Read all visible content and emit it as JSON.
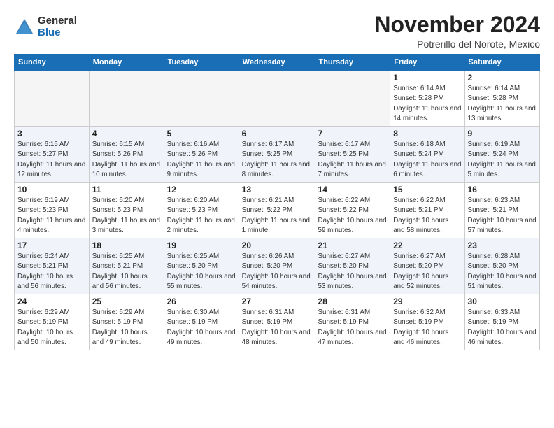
{
  "logo": {
    "general": "General",
    "blue": "Blue"
  },
  "title": "November 2024",
  "subtitle": "Potrerillo del Norote, Mexico",
  "weekdays": [
    "Sunday",
    "Monday",
    "Tuesday",
    "Wednesday",
    "Thursday",
    "Friday",
    "Saturday"
  ],
  "weeks": [
    [
      {
        "day": "",
        "info": ""
      },
      {
        "day": "",
        "info": ""
      },
      {
        "day": "",
        "info": ""
      },
      {
        "day": "",
        "info": ""
      },
      {
        "day": "",
        "info": ""
      },
      {
        "day": "1",
        "info": "Sunrise: 6:14 AM\nSunset: 5:28 PM\nDaylight: 11 hours and 14 minutes."
      },
      {
        "day": "2",
        "info": "Sunrise: 6:14 AM\nSunset: 5:28 PM\nDaylight: 11 hours and 13 minutes."
      }
    ],
    [
      {
        "day": "3",
        "info": "Sunrise: 6:15 AM\nSunset: 5:27 PM\nDaylight: 11 hours and 12 minutes."
      },
      {
        "day": "4",
        "info": "Sunrise: 6:15 AM\nSunset: 5:26 PM\nDaylight: 11 hours and 10 minutes."
      },
      {
        "day": "5",
        "info": "Sunrise: 6:16 AM\nSunset: 5:26 PM\nDaylight: 11 hours and 9 minutes."
      },
      {
        "day": "6",
        "info": "Sunrise: 6:17 AM\nSunset: 5:25 PM\nDaylight: 11 hours and 8 minutes."
      },
      {
        "day": "7",
        "info": "Sunrise: 6:17 AM\nSunset: 5:25 PM\nDaylight: 11 hours and 7 minutes."
      },
      {
        "day": "8",
        "info": "Sunrise: 6:18 AM\nSunset: 5:24 PM\nDaylight: 11 hours and 6 minutes."
      },
      {
        "day": "9",
        "info": "Sunrise: 6:19 AM\nSunset: 5:24 PM\nDaylight: 11 hours and 5 minutes."
      }
    ],
    [
      {
        "day": "10",
        "info": "Sunrise: 6:19 AM\nSunset: 5:23 PM\nDaylight: 11 hours and 4 minutes."
      },
      {
        "day": "11",
        "info": "Sunrise: 6:20 AM\nSunset: 5:23 PM\nDaylight: 11 hours and 3 minutes."
      },
      {
        "day": "12",
        "info": "Sunrise: 6:20 AM\nSunset: 5:23 PM\nDaylight: 11 hours and 2 minutes."
      },
      {
        "day": "13",
        "info": "Sunrise: 6:21 AM\nSunset: 5:22 PM\nDaylight: 11 hours and 1 minute."
      },
      {
        "day": "14",
        "info": "Sunrise: 6:22 AM\nSunset: 5:22 PM\nDaylight: 10 hours and 59 minutes."
      },
      {
        "day": "15",
        "info": "Sunrise: 6:22 AM\nSunset: 5:21 PM\nDaylight: 10 hours and 58 minutes."
      },
      {
        "day": "16",
        "info": "Sunrise: 6:23 AM\nSunset: 5:21 PM\nDaylight: 10 hours and 57 minutes."
      }
    ],
    [
      {
        "day": "17",
        "info": "Sunrise: 6:24 AM\nSunset: 5:21 PM\nDaylight: 10 hours and 56 minutes."
      },
      {
        "day": "18",
        "info": "Sunrise: 6:25 AM\nSunset: 5:21 PM\nDaylight: 10 hours and 56 minutes."
      },
      {
        "day": "19",
        "info": "Sunrise: 6:25 AM\nSunset: 5:20 PM\nDaylight: 10 hours and 55 minutes."
      },
      {
        "day": "20",
        "info": "Sunrise: 6:26 AM\nSunset: 5:20 PM\nDaylight: 10 hours and 54 minutes."
      },
      {
        "day": "21",
        "info": "Sunrise: 6:27 AM\nSunset: 5:20 PM\nDaylight: 10 hours and 53 minutes."
      },
      {
        "day": "22",
        "info": "Sunrise: 6:27 AM\nSunset: 5:20 PM\nDaylight: 10 hours and 52 minutes."
      },
      {
        "day": "23",
        "info": "Sunrise: 6:28 AM\nSunset: 5:20 PM\nDaylight: 10 hours and 51 minutes."
      }
    ],
    [
      {
        "day": "24",
        "info": "Sunrise: 6:29 AM\nSunset: 5:19 PM\nDaylight: 10 hours and 50 minutes."
      },
      {
        "day": "25",
        "info": "Sunrise: 6:29 AM\nSunset: 5:19 PM\nDaylight: 10 hours and 49 minutes."
      },
      {
        "day": "26",
        "info": "Sunrise: 6:30 AM\nSunset: 5:19 PM\nDaylight: 10 hours and 49 minutes."
      },
      {
        "day": "27",
        "info": "Sunrise: 6:31 AM\nSunset: 5:19 PM\nDaylight: 10 hours and 48 minutes."
      },
      {
        "day": "28",
        "info": "Sunrise: 6:31 AM\nSunset: 5:19 PM\nDaylight: 10 hours and 47 minutes."
      },
      {
        "day": "29",
        "info": "Sunrise: 6:32 AM\nSunset: 5:19 PM\nDaylight: 10 hours and 46 minutes."
      },
      {
        "day": "30",
        "info": "Sunrise: 6:33 AM\nSunset: 5:19 PM\nDaylight: 10 hours and 46 minutes."
      }
    ]
  ]
}
